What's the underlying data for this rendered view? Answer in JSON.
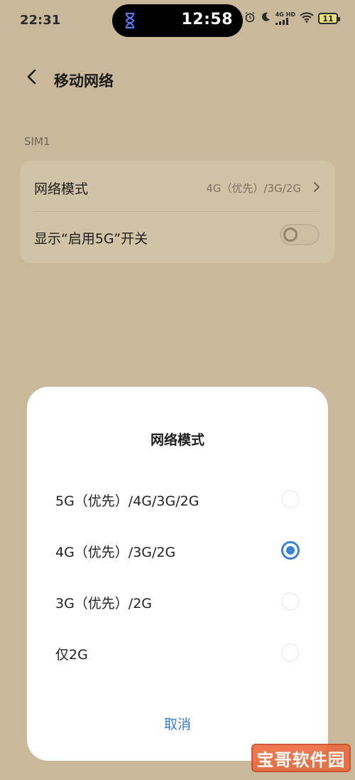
{
  "status_bar": {
    "time": "22:31",
    "island_time": "12:58",
    "network_label_top": "4G HD",
    "battery": "11",
    "icons": [
      "hourglass-icon",
      "alarm-icon",
      "moon-icon",
      "signal-icon",
      "wifi-icon",
      "battery-icon"
    ]
  },
  "header": {
    "title": "移动网络",
    "back_icon": "chevron-left-icon"
  },
  "section_label": "SIM1",
  "settings": {
    "network_mode_label": "网络模式",
    "network_mode_value": "4G（优先）/3G/2G",
    "show_5g_label": "显示“启用5G”开关",
    "show_5g_enabled": false
  },
  "dialog": {
    "title": "网络模式",
    "options": [
      {
        "label": "5G（优先）/4G/3G/2G",
        "selected": false
      },
      {
        "label": "4G（优先）/3G/2G",
        "selected": true
      },
      {
        "label": "3G（优先）/2G",
        "selected": false
      },
      {
        "label": "仅2G",
        "selected": false
      }
    ],
    "cancel_label": "取消"
  },
  "watermark": "宝哥软件园",
  "colors": {
    "background": "#c9b99a",
    "card": "#d1c3a6",
    "accent": "#3b82d6",
    "dialog": "#ffffff",
    "watermark": "#e96a3e"
  }
}
